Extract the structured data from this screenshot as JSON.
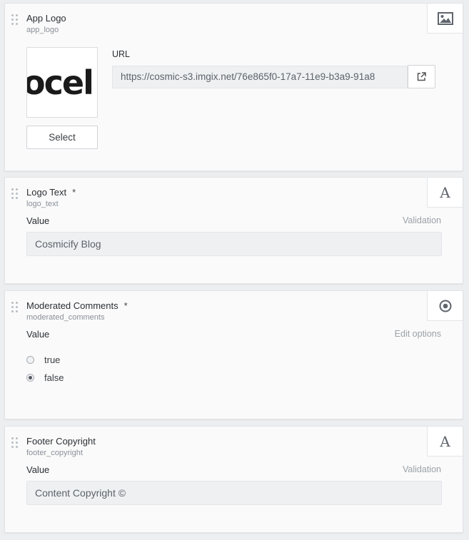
{
  "cards": [
    {
      "title": "App Logo",
      "key": "app_logo",
      "type_icon": "image-icon",
      "preview_text": "ocel",
      "select_label": "Select",
      "url_label": "URL",
      "url_value": "https://cosmic-s3.imgix.net/76e865f0-17a7-11e9-b3a9-91a8",
      "url_button_icon": "external-link-icon"
    },
    {
      "title": "Logo Text",
      "required": "*",
      "key": "logo_text",
      "type_icon": "text-icon",
      "type_glyph": "A",
      "value_label": "Value",
      "action_link": "Validation",
      "input_value": "Cosmicify Blog"
    },
    {
      "title": "Moderated Comments",
      "required": "*",
      "key": "moderated_comments",
      "type_icon": "radio-icon",
      "value_label": "Value",
      "action_link": "Edit options",
      "options": [
        {
          "label": "true",
          "checked": false
        },
        {
          "label": "false",
          "checked": true
        }
      ]
    },
    {
      "title": "Footer Copyright",
      "key": "footer_copyright",
      "type_icon": "text-icon",
      "type_glyph": "A",
      "value_label": "Value",
      "action_link": "Validation",
      "input_value": "Content Copyright ©"
    }
  ]
}
